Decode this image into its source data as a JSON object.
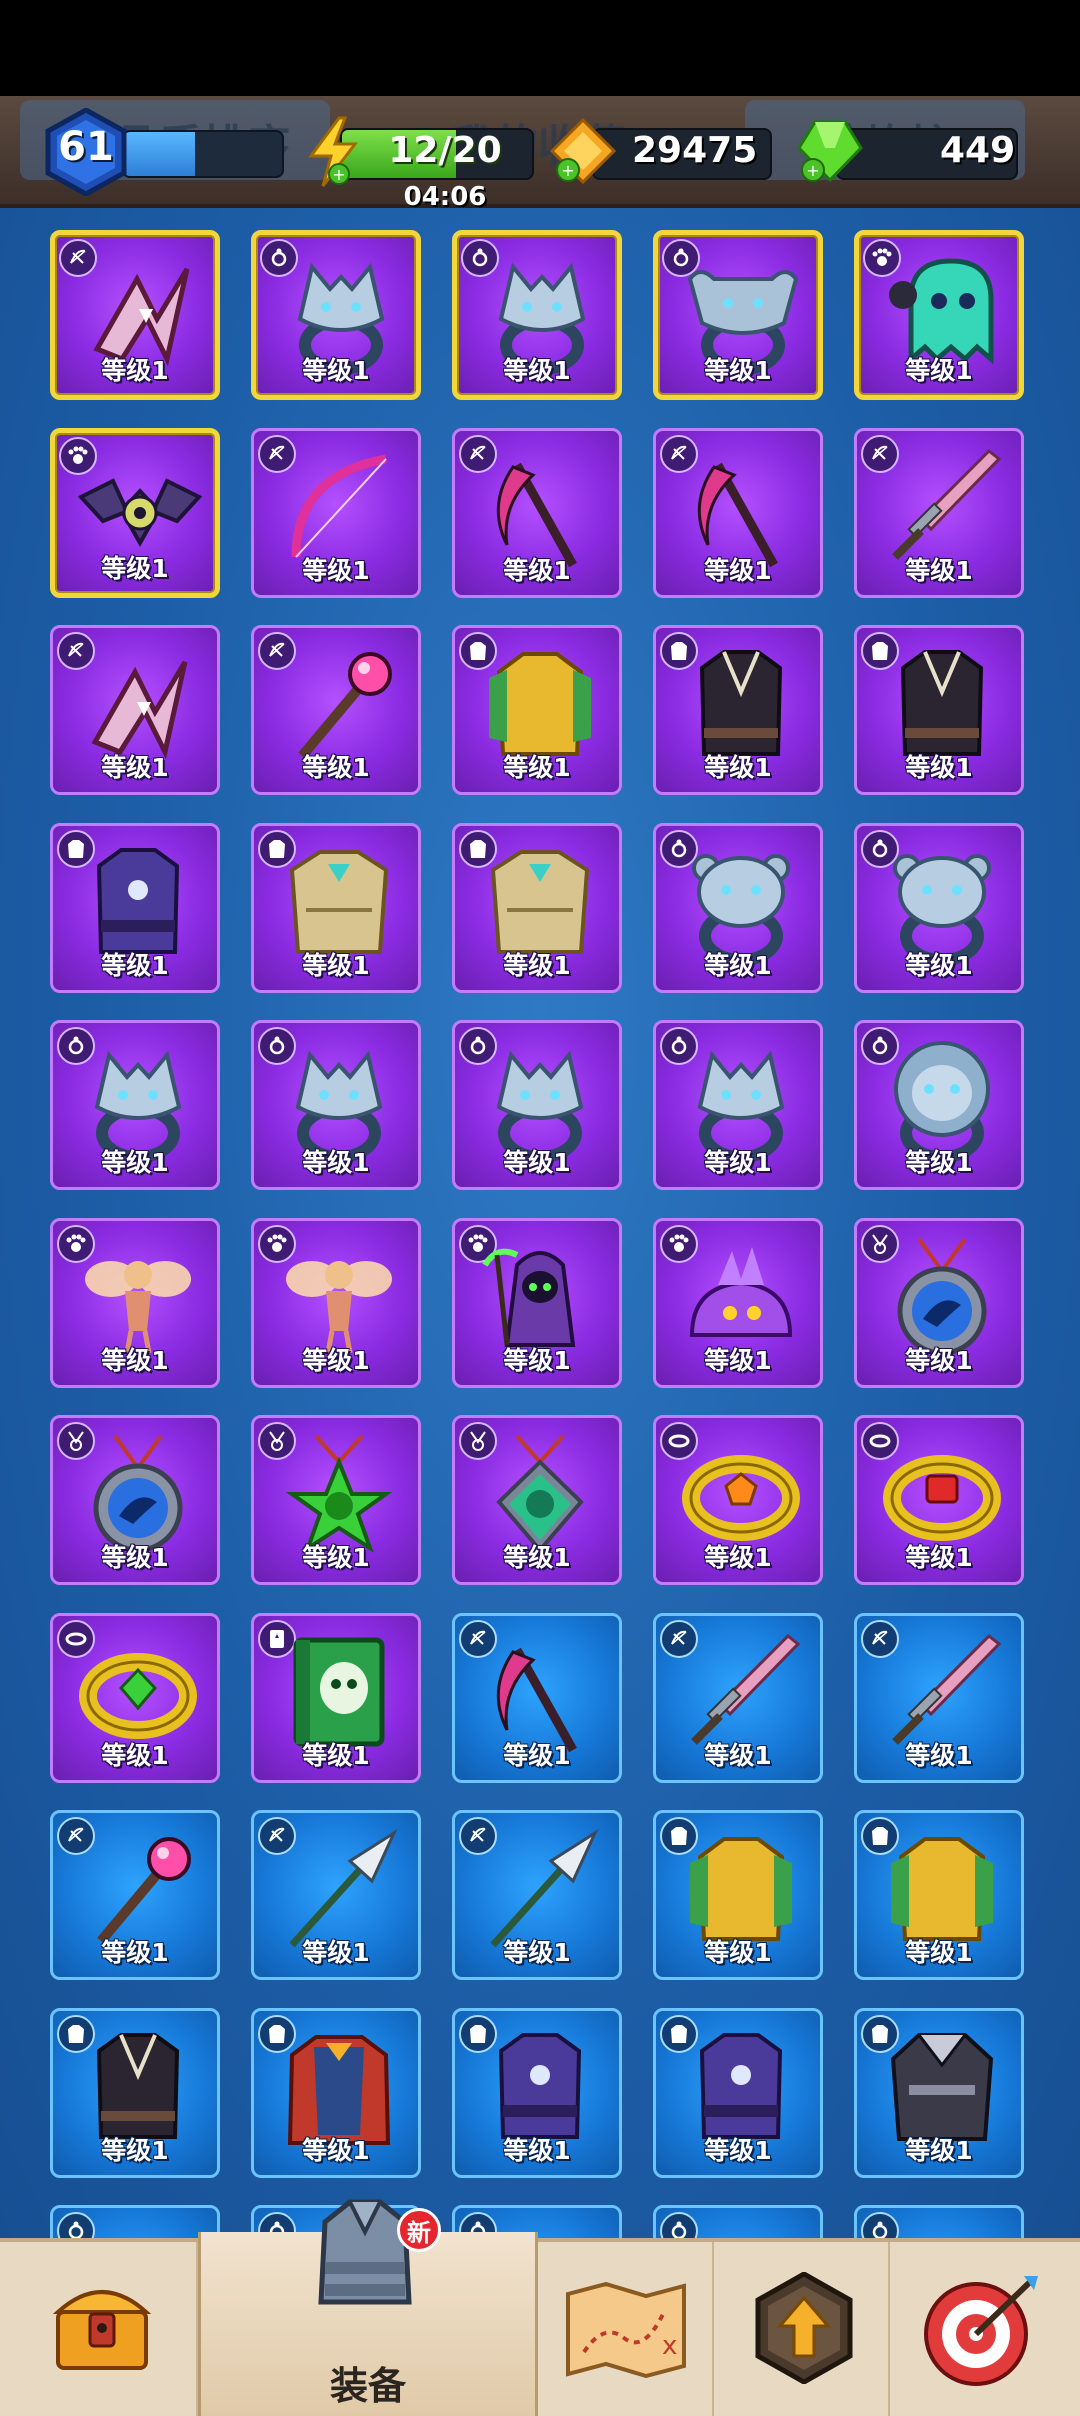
{
  "hud": {
    "player_level": "61",
    "level_progress": 0.45,
    "energy": "12/20",
    "energy_progress": 0.6,
    "energy_timer": "04:06",
    "coins": "29475",
    "gems": "449",
    "sort_tab_ghost": "按品质排序",
    "collection_tab_ghost": "我的收藏",
    "refine_tab_ghost": "熔炼炉"
  },
  "colors": {
    "purple_card": "#8a2be2",
    "blue_card": "#1677d6",
    "gold_frame": "#f2d63c",
    "energy_green": "#4cc22a",
    "coin_orange": "#f5a623",
    "gem_green": "#5fdc2e"
  },
  "level_label": "等级1",
  "rows": [
    {
      "cards": [
        {
          "icon": "weapon-bow-icon",
          "item": "boomerang-icon",
          "rarity": "purple",
          "gold": true,
          "label": "等级1"
        },
        {
          "icon": "ring-slot-icon",
          "item": "wolf-ring-icon",
          "rarity": "purple",
          "gold": true,
          "label": "等级1"
        },
        {
          "icon": "ring-slot-icon",
          "item": "wolf-ring-icon",
          "rarity": "purple",
          "gold": true,
          "label": "等级1"
        },
        {
          "icon": "ring-slot-icon",
          "item": "bull-ring-icon",
          "rarity": "purple",
          "gold": true,
          "label": "等级1"
        },
        {
          "icon": "pet-paw-icon",
          "item": "ghost-pet-icon",
          "rarity": "purple",
          "gold": true,
          "label": "等级1"
        }
      ]
    },
    {
      "cards": [
        {
          "icon": "pet-paw-icon",
          "item": "bat-pet-icon",
          "rarity": "purple",
          "gold": true,
          "label": "等级1"
        },
        {
          "icon": "weapon-bow-icon",
          "item": "bow-icon",
          "rarity": "purple",
          "gold": false,
          "label": "等级1"
        },
        {
          "icon": "weapon-bow-icon",
          "item": "scythe-icon",
          "rarity": "purple",
          "gold": false,
          "label": "等级1"
        },
        {
          "icon": "weapon-bow-icon",
          "item": "scythe-icon",
          "rarity": "purple",
          "gold": false,
          "label": "等级1"
        },
        {
          "icon": "weapon-bow-icon",
          "item": "sword-icon",
          "rarity": "purple",
          "gold": false,
          "label": "等级1"
        }
      ]
    },
    {
      "cards": [
        {
          "icon": "weapon-bow-icon",
          "item": "boomerang-icon",
          "rarity": "purple",
          "gold": false,
          "label": "等级1"
        },
        {
          "icon": "weapon-bow-icon",
          "item": "staff-icon",
          "rarity": "purple",
          "gold": false,
          "label": "等级1"
        },
        {
          "icon": "armor-slot-icon",
          "item": "gold-armor-icon",
          "rarity": "purple",
          "gold": false,
          "label": "等级1"
        },
        {
          "icon": "armor-slot-icon",
          "item": "dark-vest-icon",
          "rarity": "purple",
          "gold": false,
          "label": "等级1"
        },
        {
          "icon": "armor-slot-icon",
          "item": "dark-vest-icon",
          "rarity": "purple",
          "gold": false,
          "label": "等级1"
        }
      ]
    },
    {
      "cards": [
        {
          "icon": "armor-slot-icon",
          "item": "mage-robe-icon",
          "rarity": "purple",
          "gold": false,
          "label": "等级1"
        },
        {
          "icon": "armor-slot-icon",
          "item": "bone-armor-icon",
          "rarity": "purple",
          "gold": false,
          "label": "等级1"
        },
        {
          "icon": "armor-slot-icon",
          "item": "bone-armor-icon",
          "rarity": "purple",
          "gold": false,
          "label": "等级1"
        },
        {
          "icon": "ring-slot-icon",
          "item": "bear-ring-icon",
          "rarity": "purple",
          "gold": false,
          "label": "等级1"
        },
        {
          "icon": "ring-slot-icon",
          "item": "bear-ring-icon",
          "rarity": "purple",
          "gold": false,
          "label": "等级1"
        }
      ]
    },
    {
      "cards": [
        {
          "icon": "ring-slot-icon",
          "item": "wolf-ring-icon",
          "rarity": "purple",
          "gold": false,
          "label": "等级1"
        },
        {
          "icon": "ring-slot-icon",
          "item": "wolf-ring-icon",
          "rarity": "purple",
          "gold": false,
          "label": "等级1"
        },
        {
          "icon": "ring-slot-icon",
          "item": "wolf-ring-icon",
          "rarity": "purple",
          "gold": false,
          "label": "等级1"
        },
        {
          "icon": "ring-slot-icon",
          "item": "wolf-ring-icon",
          "rarity": "purple",
          "gold": false,
          "label": "等级1"
        },
        {
          "icon": "ring-slot-icon",
          "item": "lion-ring-icon",
          "rarity": "purple",
          "gold": false,
          "label": "等级1"
        }
      ]
    },
    {
      "cards": [
        {
          "icon": "pet-paw-icon",
          "item": "fairy-pet-icon",
          "rarity": "purple",
          "gold": false,
          "label": "等级1"
        },
        {
          "icon": "pet-paw-icon",
          "item": "fairy-pet-icon",
          "rarity": "purple",
          "gold": false,
          "label": "等级1"
        },
        {
          "icon": "pet-paw-icon",
          "item": "reaper-pet-icon",
          "rarity": "purple",
          "gold": false,
          "label": "等级1"
        },
        {
          "icon": "pet-paw-icon",
          "item": "slime-pet-icon",
          "rarity": "purple",
          "gold": false,
          "label": "等级1"
        },
        {
          "icon": "amulet-slot-icon",
          "item": "eagle-amulet-icon",
          "rarity": "purple",
          "gold": false,
          "label": "等级1"
        }
      ]
    },
    {
      "cards": [
        {
          "icon": "amulet-slot-icon",
          "item": "eagle-amulet-icon",
          "rarity": "purple",
          "gold": false,
          "label": "等级1"
        },
        {
          "icon": "amulet-slot-icon",
          "item": "star-amulet-icon",
          "rarity": "purple",
          "gold": false,
          "label": "等级1"
        },
        {
          "icon": "amulet-slot-icon",
          "item": "monkey-amulet-icon",
          "rarity": "purple",
          "gold": false,
          "label": "等级1"
        },
        {
          "icon": "bracelet-slot-icon",
          "item": "orange-bracelet-icon",
          "rarity": "purple",
          "gold": false,
          "label": "等级1"
        },
        {
          "icon": "bracelet-slot-icon",
          "item": "red-bracelet-icon",
          "rarity": "purple",
          "gold": false,
          "label": "等级1"
        }
      ]
    },
    {
      "cards": [
        {
          "icon": "bracelet-slot-icon",
          "item": "green-bracelet-icon",
          "rarity": "purple",
          "gold": false,
          "label": "等级1"
        },
        {
          "icon": "book-slot-icon",
          "item": "spellbook-icon",
          "rarity": "purple",
          "gold": false,
          "label": "等级1"
        },
        {
          "icon": "weapon-bow-icon",
          "item": "scythe-icon",
          "rarity": "blue",
          "gold": false,
          "label": "等级1"
        },
        {
          "icon": "weapon-bow-icon",
          "item": "sword-icon",
          "rarity": "blue",
          "gold": false,
          "label": "等级1"
        },
        {
          "icon": "weapon-bow-icon",
          "item": "sword-icon",
          "rarity": "blue",
          "gold": false,
          "label": "等级1"
        }
      ]
    },
    {
      "cards": [
        {
          "icon": "weapon-bow-icon",
          "item": "staff-icon",
          "rarity": "blue",
          "gold": false,
          "label": "等级1"
        },
        {
          "icon": "weapon-bow-icon",
          "item": "spear-icon",
          "rarity": "blue",
          "gold": false,
          "label": "等级1"
        },
        {
          "icon": "weapon-bow-icon",
          "item": "spear-icon",
          "rarity": "blue",
          "gold": false,
          "label": "等级1"
        },
        {
          "icon": "armor-slot-icon",
          "item": "gold-armor-icon",
          "rarity": "blue",
          "gold": false,
          "label": "等级1"
        },
        {
          "icon": "armor-slot-icon",
          "item": "gold-armor-icon",
          "rarity": "blue",
          "gold": false,
          "label": "等级1"
        }
      ]
    },
    {
      "cards": [
        {
          "icon": "armor-slot-icon",
          "item": "dark-vest-icon",
          "rarity": "blue",
          "gold": false,
          "label": "等级1"
        },
        {
          "icon": "armor-slot-icon",
          "item": "red-cape-armor-icon",
          "rarity": "blue",
          "gold": false,
          "label": "等级1"
        },
        {
          "icon": "armor-slot-icon",
          "item": "mage-robe-icon",
          "rarity": "blue",
          "gold": false,
          "label": "等级1"
        },
        {
          "icon": "armor-slot-icon",
          "item": "mage-robe-icon",
          "rarity": "blue",
          "gold": false,
          "label": "等级1"
        },
        {
          "icon": "armor-slot-icon",
          "item": "knight-armor-icon",
          "rarity": "blue",
          "gold": false,
          "label": "等级1"
        }
      ]
    },
    {
      "cards": [
        {
          "icon": "ring-slot-icon",
          "item": "ring-icon",
          "rarity": "blue",
          "gold": false,
          "label": ""
        },
        {
          "icon": "ring-slot-icon",
          "item": "ring-icon",
          "rarity": "blue",
          "gold": false,
          "label": ""
        },
        {
          "icon": "ring-slot-icon",
          "item": "ring-icon",
          "rarity": "blue",
          "gold": false,
          "label": ""
        },
        {
          "icon": "ring-slot-icon",
          "item": "ring-icon",
          "rarity": "blue",
          "gold": false,
          "label": ""
        },
        {
          "icon": "ring-slot-icon",
          "item": "ring-icon",
          "rarity": "blue",
          "gold": false,
          "label": ""
        }
      ]
    }
  ],
  "nav": {
    "items": [
      {
        "name": "nav-shop",
        "icon": "treasure-chest-icon",
        "label": ""
      },
      {
        "name": "nav-equipment",
        "icon": "armor-icon",
        "label": "装备",
        "badge": "新",
        "active": true
      },
      {
        "name": "nav-map",
        "icon": "map-icon",
        "label": ""
      },
      {
        "name": "nav-upgrade",
        "icon": "upgrade-arrow-icon",
        "label": ""
      },
      {
        "name": "nav-challenge",
        "icon": "target-icon",
        "label": ""
      }
    ]
  }
}
